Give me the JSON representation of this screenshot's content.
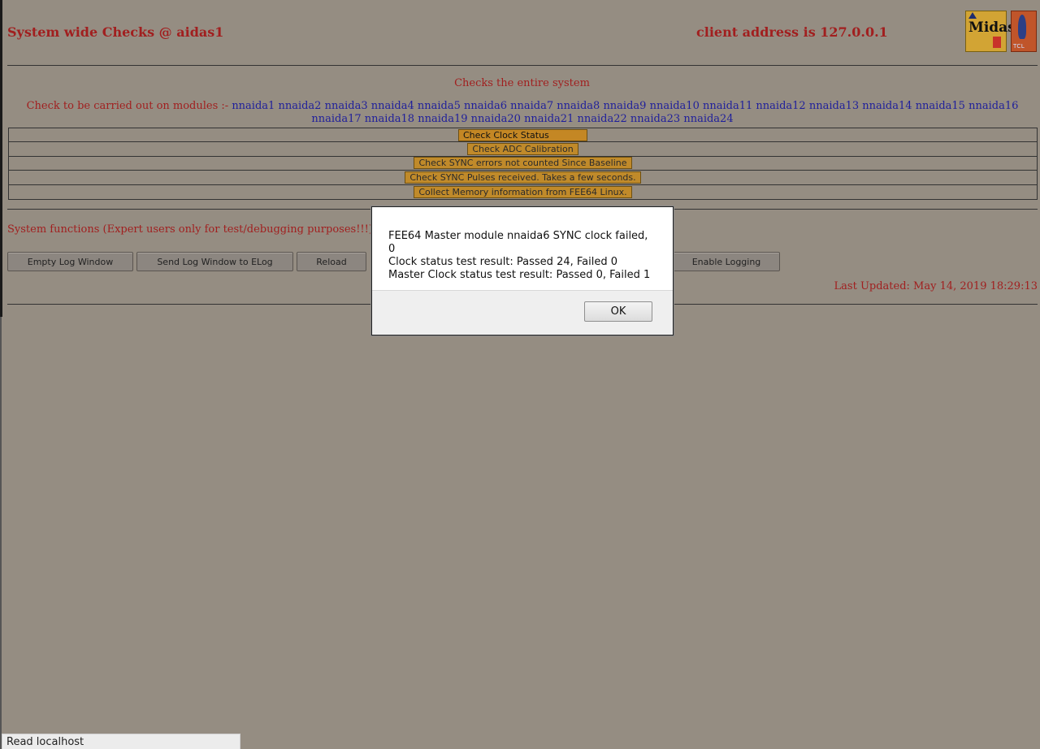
{
  "header": {
    "title": "System wide Checks @ aidas1",
    "client_address": "client address is 127.0.0.1",
    "midas_logo_text": "Midas",
    "tcl_logo_text": "TCL"
  },
  "checks": {
    "subtitle": "Checks the entire system",
    "modules_prefix": "Check to be carried out on modules :-",
    "modules": [
      "nnaida1",
      "nnaida2",
      "nnaida3",
      "nnaida4",
      "nnaida5",
      "nnaida6",
      "nnaida7",
      "nnaida8",
      "nnaida9",
      "nnaida10",
      "nnaida11",
      "nnaida12",
      "nnaida13",
      "nnaida14",
      "nnaida15",
      "nnaida16",
      "nnaida17",
      "nnaida18",
      "nnaida19",
      "nnaida20",
      "nnaida21",
      "nnaida22",
      "nnaida23",
      "nnaida24"
    ],
    "buttons": [
      "Check Clock Status",
      "Check ADC Calibration",
      "Check SYNC errors not counted Since Baseline",
      "Check SYNC Pulses received. Takes a few seconds.",
      "Collect Memory information from FEE64 Linux."
    ]
  },
  "system_functions": {
    "title": "System functions (Expert users only for test/debugging purposes!!!)",
    "buttons": {
      "empty_log": "Empty Log Window",
      "send_log": "Send Log Window to ELog",
      "reload": "Reload",
      "enable_logging": "Enable Logging"
    }
  },
  "last_updated": "Last Updated: May 14, 2019 18:29:13",
  "dialog": {
    "lines": [
      "FEE64 Master module nnaida6 SYNC clock failed, 0",
      "Clock status test result: Passed 24, Failed 0",
      "Master Clock status test result: Passed 0, Failed 1"
    ],
    "ok_label": "OK"
  },
  "status_bar": {
    "text": "Read localhost"
  }
}
